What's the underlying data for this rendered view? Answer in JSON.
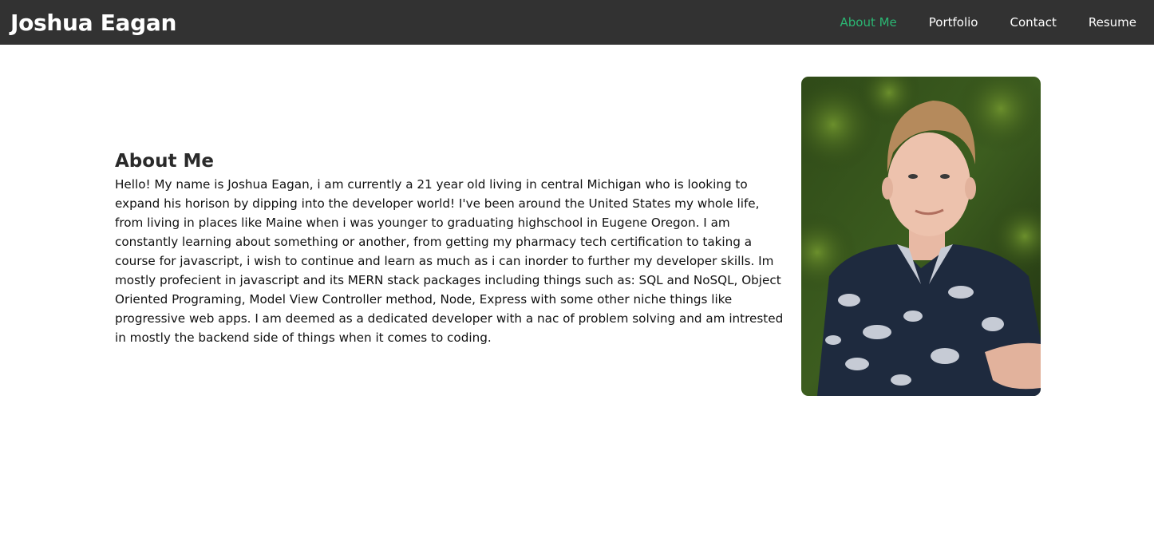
{
  "header": {
    "brand": "Joshua Eagan",
    "nav": [
      {
        "label": "About Me",
        "active": true
      },
      {
        "label": "Portfolio",
        "active": false
      },
      {
        "label": "Contact",
        "active": false
      },
      {
        "label": "Resume",
        "active": false
      }
    ]
  },
  "about": {
    "title": "About Me",
    "body": "Hello! My name is Joshua Eagan, i am currently a 21 year old living in central Michigan who is looking to expand his horison by dipping into the developer world! I've been around the United States my whole life, from living in places like Maine when i was younger to graduating highschool in Eugene Oregon. I am constantly learning about something or another, from getting my pharmacy tech certification to taking a course for javascript, i wish to continue and learn as much as i can inorder to further my developer skills. Im mostly profecient in javascript and its MERN stack packages including things such as: SQL and NoSQL, Object Oriented Programing, Model View Controller method, Node, Express with some other niche things like progressive web apps. I am deemed as a dedicated developer with a nac of problem solving and am intrested in mostly the backend side of things when it comes to coding."
  },
  "colors": {
    "navbar_bg": "#323232",
    "accent": "#2bb673"
  }
}
